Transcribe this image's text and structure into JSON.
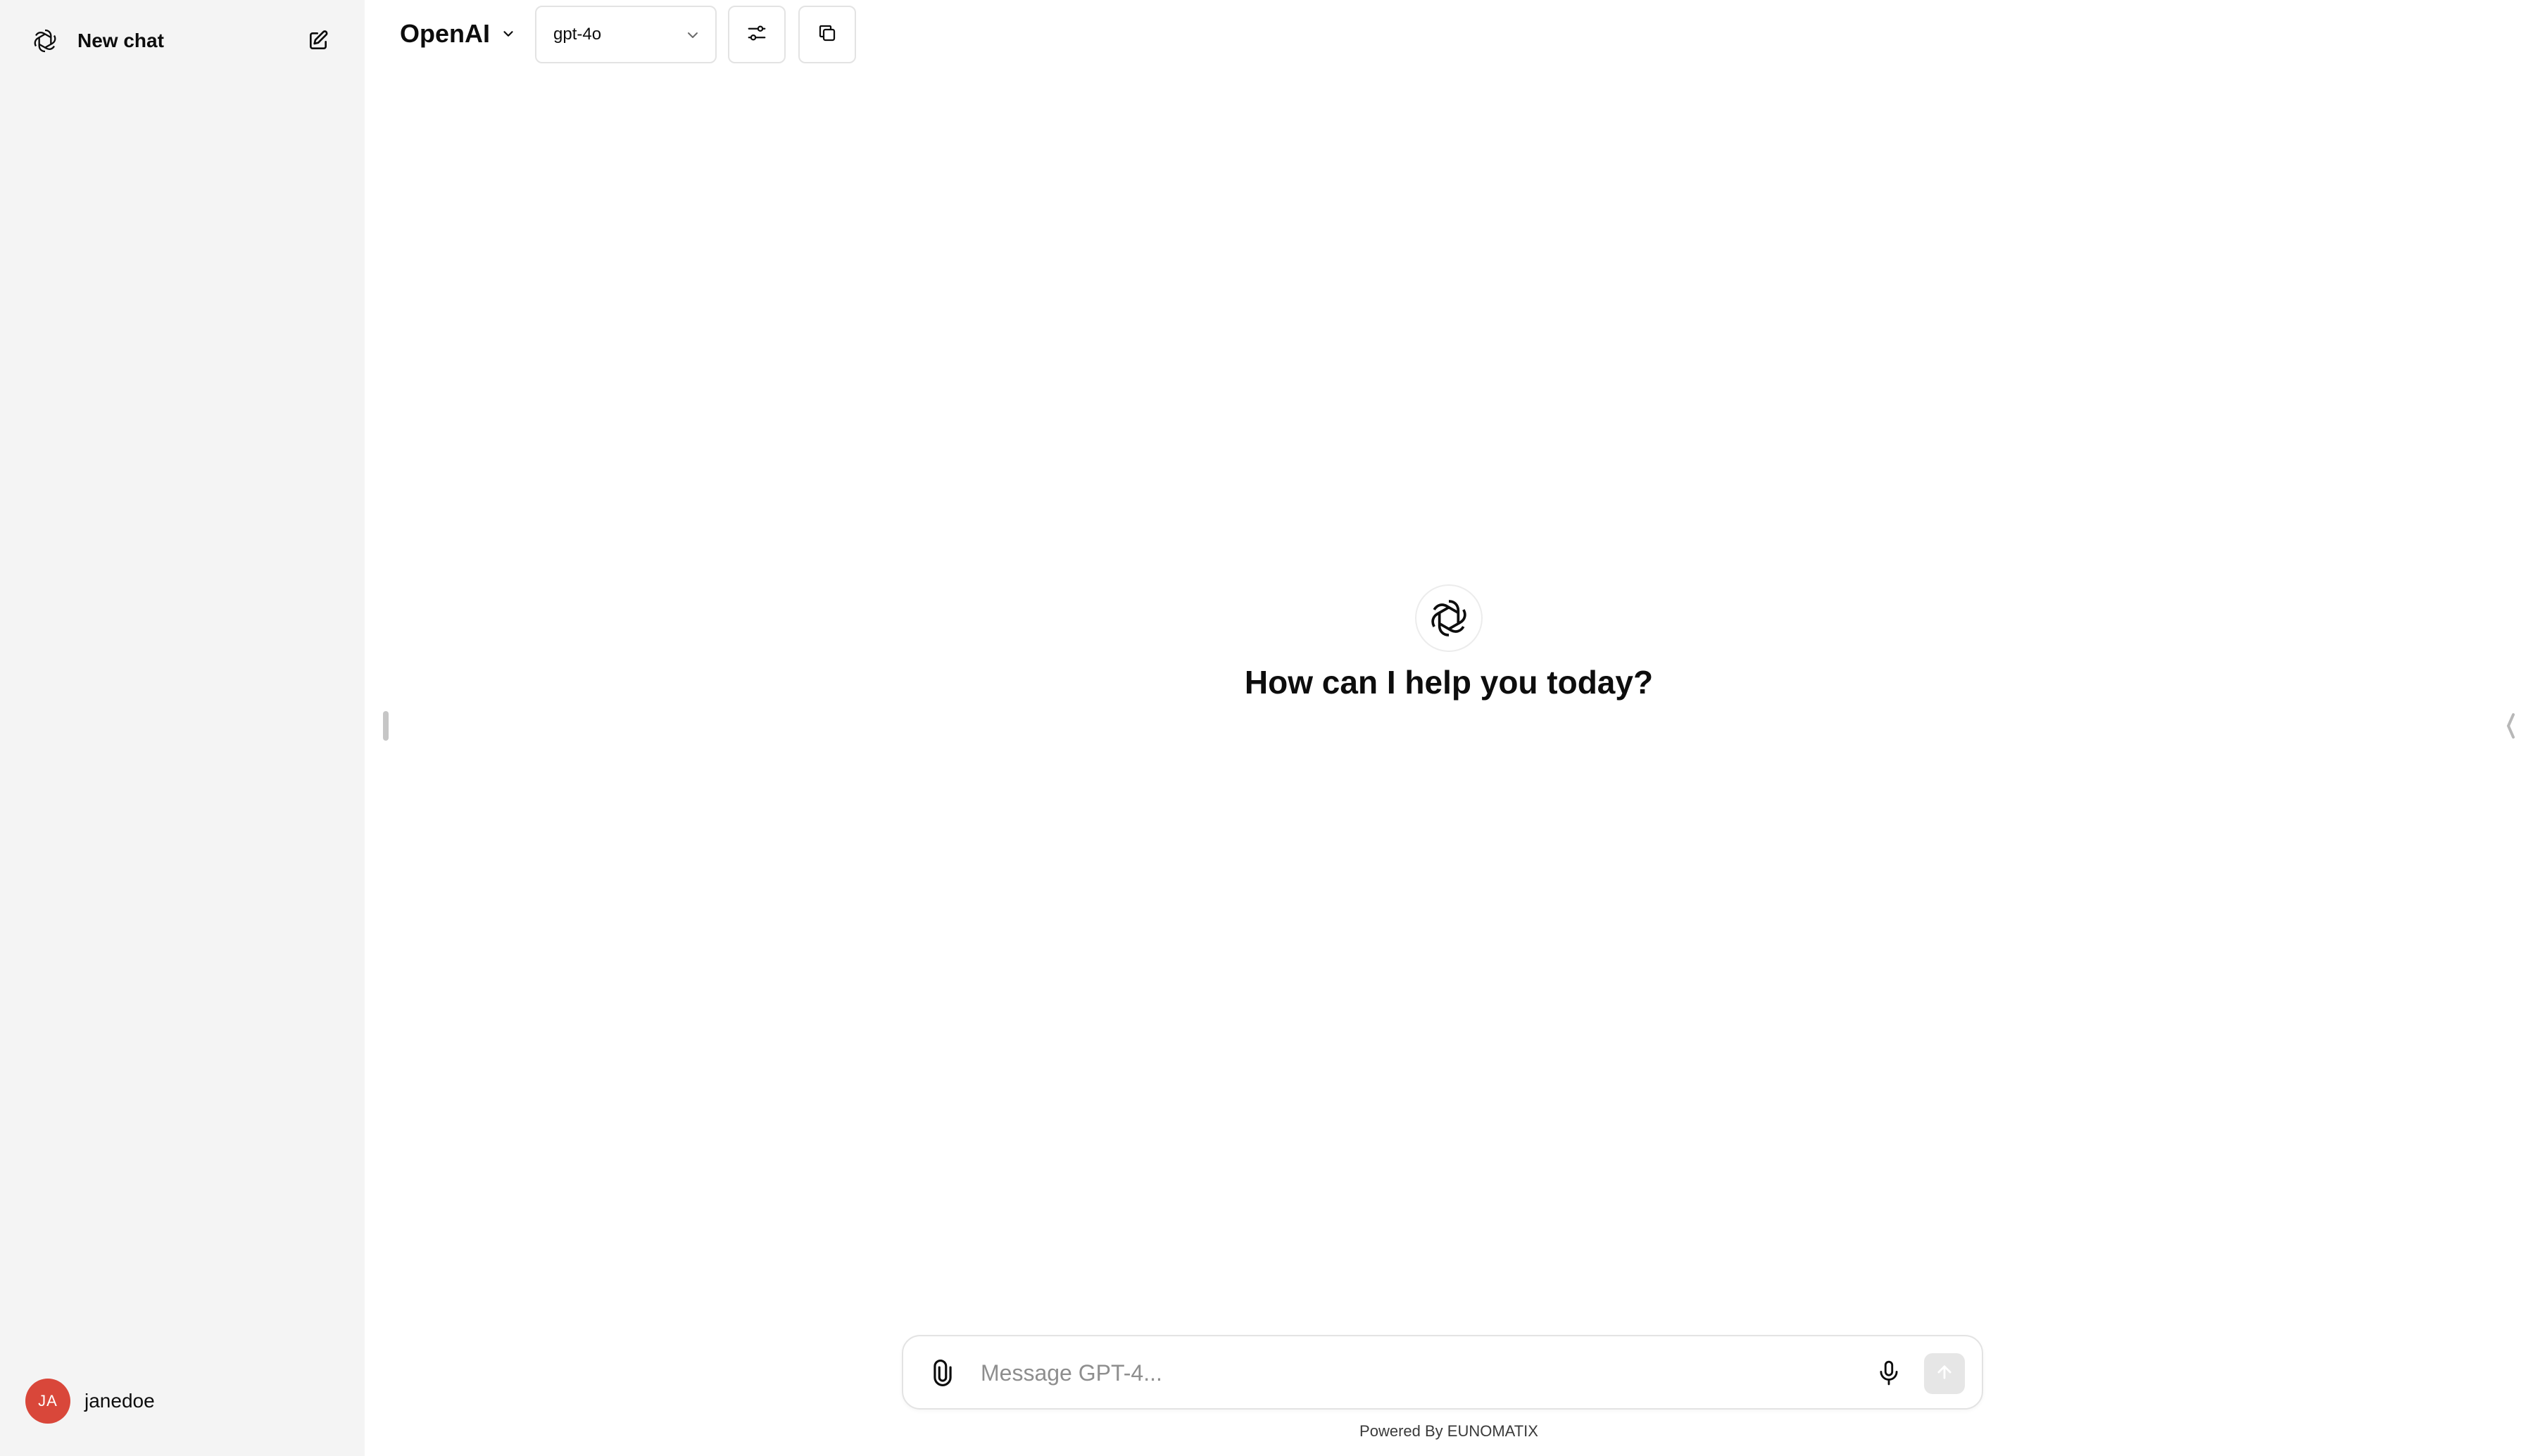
{
  "sidebar": {
    "new_chat_label": "New chat",
    "new_chat_icon": "openai-logo-icon",
    "edit_icon": "compose-icon",
    "user": {
      "initials": "JA",
      "name": "janedoe",
      "avatar_color": "#d9473a"
    }
  },
  "header": {
    "endpoint_label": "OpenAI",
    "model_label": "gpt-4o",
    "settings_icon": "sliders-icon",
    "copy_icon": "copy-icon"
  },
  "main": {
    "greeting": "How can I help you today?",
    "logo_icon": "openai-logo-icon"
  },
  "composer": {
    "placeholder": "Message GPT-4...",
    "attach_icon": "paperclip-icon",
    "mic_icon": "microphone-icon",
    "send_icon": "arrow-up-icon"
  },
  "footer": {
    "prefix": "Powered By ",
    "brand": "EUNOMATIX"
  },
  "colors": {
    "sidebar_bg": "#f4f4f4",
    "main_bg": "#ffffff",
    "border": "#e3e3e3",
    "send_disabled": "#e6e6e6"
  }
}
